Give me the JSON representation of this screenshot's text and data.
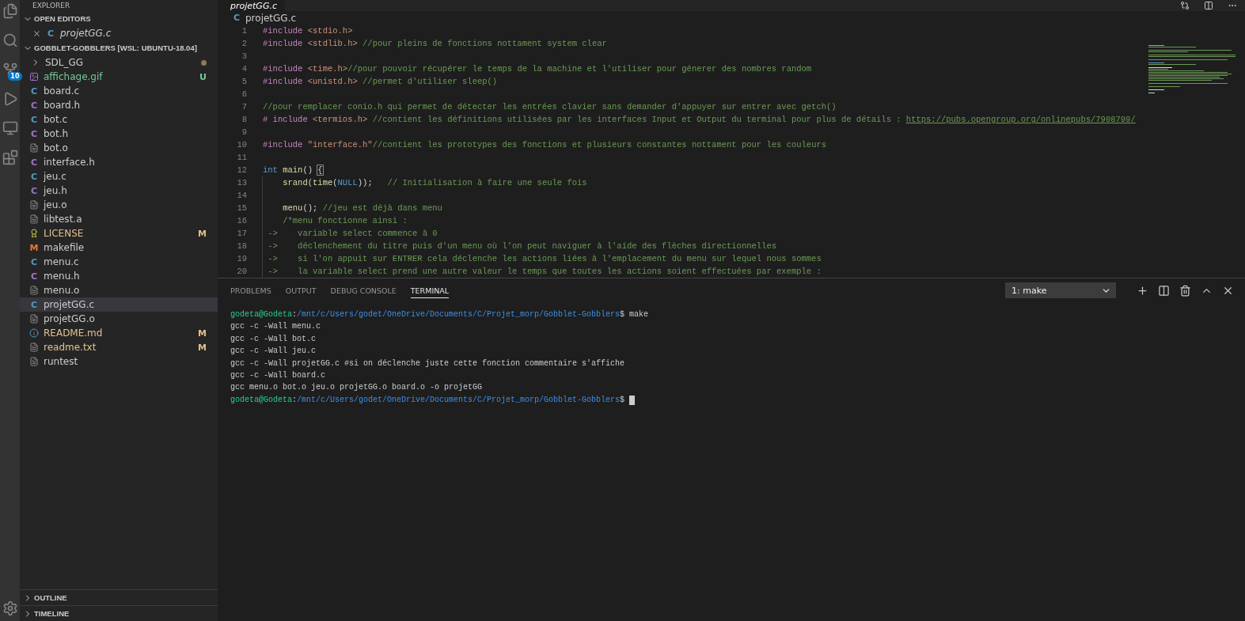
{
  "sidebar": {
    "title": "EXPLORER",
    "open_editors": {
      "title": "OPEN EDITORS",
      "expanded": true,
      "items": [
        {
          "name": "projetGG.c",
          "kind": "source",
          "glyph": "C",
          "selected": false
        }
      ]
    },
    "project": {
      "title": "GOBBLET-GOBBLERS [WSL: UBUNTU-18.04]",
      "expanded": true,
      "items": [
        {
          "name": "SDL_GG",
          "kind": "folder",
          "expanded": false,
          "has_changes": true,
          "untracked": false,
          "modified": false,
          "selected": false
        },
        {
          "name": "affichage.gif",
          "kind": "image",
          "badge": "U",
          "has_changes": false,
          "untracked": true,
          "modified": false,
          "selected": false
        },
        {
          "name": "board.c",
          "kind": "source",
          "glyph": "C",
          "has_changes": false,
          "untracked": false,
          "modified": false,
          "selected": false
        },
        {
          "name": "board.h",
          "kind": "header",
          "glyph": "C",
          "has_changes": false,
          "untracked": false,
          "modified": false,
          "selected": false
        },
        {
          "name": "bot.c",
          "kind": "source",
          "glyph": "C",
          "has_changes": false,
          "untracked": false,
          "modified": false,
          "selected": false
        },
        {
          "name": "bot.h",
          "kind": "header",
          "glyph": "C",
          "has_changes": false,
          "untracked": false,
          "modified": false,
          "selected": false
        },
        {
          "name": "bot.o",
          "kind": "plain",
          "has_changes": false,
          "untracked": false,
          "modified": false,
          "selected": false
        },
        {
          "name": "interface.h",
          "kind": "header",
          "glyph": "C",
          "has_changes": false,
          "untracked": false,
          "modified": false,
          "selected": false
        },
        {
          "name": "jeu.c",
          "kind": "source",
          "glyph": "C",
          "has_changes": false,
          "untracked": false,
          "modified": false,
          "selected": false
        },
        {
          "name": "jeu.h",
          "kind": "header",
          "glyph": "C",
          "has_changes": false,
          "untracked": false,
          "modified": false,
          "selected": false
        },
        {
          "name": "jeu.o",
          "kind": "plain",
          "has_changes": false,
          "untracked": false,
          "modified": false,
          "selected": false
        },
        {
          "name": "libtest.a",
          "kind": "plain",
          "has_changes": false,
          "untracked": false,
          "modified": false,
          "selected": false
        },
        {
          "name": "LICENSE",
          "kind": "license",
          "badge": "M",
          "has_changes": false,
          "untracked": false,
          "modified": true,
          "selected": false
        },
        {
          "name": "makefile",
          "kind": "make",
          "glyph": "M",
          "has_changes": false,
          "untracked": false,
          "modified": false,
          "selected": false
        },
        {
          "name": "menu.c",
          "kind": "source",
          "glyph": "C",
          "has_changes": false,
          "untracked": false,
          "modified": false,
          "selected": false
        },
        {
          "name": "menu.h",
          "kind": "header",
          "glyph": "C",
          "has_changes": false,
          "untracked": false,
          "modified": false,
          "selected": false
        },
        {
          "name": "menu.o",
          "kind": "plain",
          "has_changes": false,
          "untracked": false,
          "modified": false,
          "selected": false
        },
        {
          "name": "projetGG.c",
          "kind": "source",
          "glyph": "C",
          "has_changes": false,
          "untracked": false,
          "modified": false,
          "selected": true
        },
        {
          "name": "projetGG.o",
          "kind": "plain",
          "has_changes": false,
          "untracked": false,
          "modified": false,
          "selected": false
        },
        {
          "name": "README.md",
          "kind": "info",
          "badge": "M",
          "has_changes": false,
          "untracked": false,
          "modified": true,
          "selected": false
        },
        {
          "name": "readme.txt",
          "kind": "plain",
          "badge": "M",
          "has_changes": false,
          "untracked": false,
          "modified": true,
          "selected": false
        },
        {
          "name": "runtest",
          "kind": "plain",
          "has_changes": false,
          "untracked": false,
          "modified": false,
          "selected": false
        }
      ]
    },
    "bottom_sections": [
      {
        "title": "OUTLINE",
        "expanded": false
      },
      {
        "title": "TIMELINE",
        "expanded": false
      }
    ]
  },
  "activity_bar": {
    "source_control_badge": "10"
  },
  "editor": {
    "tab": {
      "label": "projetGG.c",
      "selected": true
    },
    "breadcrumb": {
      "glyph": "C",
      "label": "projetGG.c"
    },
    "lines": [
      {
        "number": "1",
        "in_block": false,
        "tokens": [
          {
            "kind": "directive",
            "t": "#include"
          },
          {
            "kind": "string",
            "t": " <stdio.h>"
          }
        ]
      },
      {
        "number": "2",
        "in_block": false,
        "tokens": [
          {
            "kind": "directive",
            "t": "#include"
          },
          {
            "kind": "string",
            "t": " <stdlib.h>"
          },
          {
            "kind": "comment",
            "t": " //pour pleins de fonctions nottament system clear"
          }
        ]
      },
      {
        "number": "3",
        "in_block": false
      },
      {
        "number": "4",
        "in_block": false,
        "tokens": [
          {
            "kind": "directive",
            "t": "#include"
          },
          {
            "kind": "string",
            "t": " <time.h>"
          },
          {
            "kind": "comment",
            "t": "//pour pouvoir récupérer le temps de la machine et l'utiliser pour génerer des nombres random"
          }
        ]
      },
      {
        "number": "5",
        "in_block": false,
        "tokens": [
          {
            "kind": "directive",
            "t": "#include"
          },
          {
            "kind": "string",
            "t": " <unistd.h>"
          },
          {
            "kind": "comment",
            "t": " //permet d'utiliser sleep()"
          }
        ]
      },
      {
        "number": "6",
        "in_block": false
      },
      {
        "number": "7",
        "in_block": false,
        "tokens": [
          {
            "kind": "comment",
            "t": "//pour remplacer conio.h qui permet de détecter les entrées clavier sans demander d'appuyer sur entrer avec getch()"
          }
        ]
      },
      {
        "number": "8",
        "in_block": false,
        "tokens": [
          {
            "kind": "directive",
            "t": "# include"
          },
          {
            "kind": "string",
            "t": " <termios.h>"
          },
          {
            "kind": "comment",
            "t": " //contient les définitions utilisées par les interfaces Input et Output du terminal pour plus de détails : "
          },
          {
            "kind": "link",
            "t": "https://pubs.opengroup.org/onlinepubs/7908799/"
          }
        ]
      },
      {
        "number": "9",
        "in_block": false
      },
      {
        "number": "10",
        "in_block": false,
        "tokens": [
          {
            "kind": "directive",
            "t": "#include"
          },
          {
            "kind": "string",
            "t": " \"interface.h\""
          },
          {
            "kind": "comment",
            "t": "//contient les prototypes des fonctions et plusieurs constantes nottament pour les couleurs"
          }
        ]
      },
      {
        "number": "11",
        "in_block": false
      },
      {
        "number": "12",
        "in_block": false,
        "tokens": [
          {
            "kind": "type",
            "t": "int"
          },
          {
            "kind": "function",
            "t": " main"
          },
          {
            "kind": "plain",
            "t": "() "
          },
          {
            "kind": "bracket",
            "t": "{"
          }
        ]
      },
      {
        "number": "13",
        "in_block": true,
        "tokens": [
          {
            "kind": "function",
            "t": "    srand"
          },
          {
            "kind": "plain",
            "t": "("
          },
          {
            "kind": "function",
            "t": "time"
          },
          {
            "kind": "plain",
            "t": "("
          },
          {
            "kind": "constant",
            "t": "NULL"
          },
          {
            "kind": "plain",
            "t": "));   "
          },
          {
            "kind": "comment",
            "t": "// Initialisation à faire une seule fois"
          }
        ]
      },
      {
        "number": "14",
        "in_block": true
      },
      {
        "number": "15",
        "in_block": true,
        "tokens": [
          {
            "kind": "function",
            "t": "    menu"
          },
          {
            "kind": "plain",
            "t": "(); "
          },
          {
            "kind": "comment",
            "t": "//jeu est déjà dans menu"
          }
        ]
      },
      {
        "number": "16",
        "in_block": true,
        "tokens": [
          {
            "kind": "comment",
            "t": "    /*menu fonctionne ainsi :"
          }
        ]
      },
      {
        "number": "17",
        "in_block": true,
        "tokens": [
          {
            "kind": "comment",
            "t": " ->    variable select commence à 0"
          }
        ]
      },
      {
        "number": "18",
        "in_block": true,
        "tokens": [
          {
            "kind": "comment",
            "t": " ->    déclenchement du titre puis d'un menu où l'on peut naviguer à l'aide des flèches directionnelles"
          }
        ]
      },
      {
        "number": "19",
        "in_block": true,
        "tokens": [
          {
            "kind": "comment",
            "t": " ->    si l'on appuit sur ENTRER cela déclenche les actions liées à l'emplacement du menu sur lequel nous sommes"
          }
        ]
      },
      {
        "number": "20",
        "in_block": true,
        "tokens": [
          {
            "kind": "comment",
            "t": " ->    la variable select prend une autre valeur le temps que toutes les actions soient effectuées par exemple :"
          }
        ]
      }
    ]
  },
  "panel": {
    "tabs": [
      {
        "label": "PROBLEMS",
        "selected": false
      },
      {
        "label": "OUTPUT",
        "selected": false
      },
      {
        "label": "DEBUG CONSOLE",
        "selected": false
      },
      {
        "label": "TERMINAL",
        "selected": true
      }
    ],
    "terminal_select": "1: make",
    "terminal_lines": [
      {
        "cursor": false,
        "segments": [
          {
            "kind": "user",
            "t": "godeta@Godeta"
          },
          {
            "kind": "plain",
            "t": ":"
          },
          {
            "kind": "path",
            "t": "/mnt/c/Users/godet/OneDrive/Documents/C/Projet_morp/Gobblet-Gobblers"
          },
          {
            "kind": "plain",
            "t": "$ make"
          }
        ]
      },
      {
        "cursor": false,
        "segments": [
          {
            "kind": "plain",
            "t": "gcc -c -Wall menu.c"
          }
        ]
      },
      {
        "cursor": false,
        "segments": [
          {
            "kind": "plain",
            "t": "gcc -c -Wall bot.c"
          }
        ]
      },
      {
        "cursor": false,
        "segments": [
          {
            "kind": "plain",
            "t": "gcc -c -Wall jeu.c"
          }
        ]
      },
      {
        "cursor": false,
        "segments": [
          {
            "kind": "plain",
            "t": "gcc -c -Wall projetGG.c #si on déclenche juste cette fonction commentaire s'affiche"
          }
        ]
      },
      {
        "cursor": false,
        "segments": [
          {
            "kind": "plain",
            "t": "gcc -c -Wall board.c"
          }
        ]
      },
      {
        "cursor": false,
        "segments": [
          {
            "kind": "plain",
            "t": "gcc menu.o bot.o jeu.o projetGG.o board.o -o projetGG"
          }
        ]
      },
      {
        "cursor": true,
        "segments": [
          {
            "kind": "user",
            "t": "godeta@Godeta"
          },
          {
            "kind": "plain",
            "t": ":"
          },
          {
            "kind": "path",
            "t": "/mnt/c/Users/godet/OneDrive/Documents/C/Projet_morp/Gobblet-Gobblers"
          },
          {
            "kind": "plain",
            "t": "$"
          }
        ]
      }
    ]
  }
}
